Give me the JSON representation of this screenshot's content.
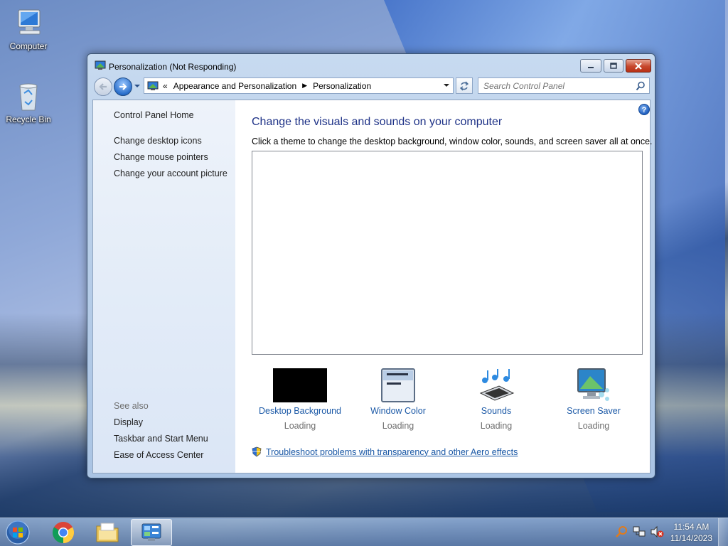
{
  "desktop": {
    "icons": [
      {
        "label": "Computer",
        "icon": "computer-icon"
      },
      {
        "label": "Recycle Bin",
        "icon": "recycle-bin-icon"
      }
    ]
  },
  "window": {
    "title": "Personalization (Not Responding)",
    "address": {
      "overflow": "«",
      "crumbs": [
        "Appearance and Personalization",
        "Personalization"
      ]
    },
    "search": {
      "placeholder": "Search Control Panel"
    },
    "sidebar": {
      "home": "Control Panel Home",
      "links": [
        "Change desktop icons",
        "Change mouse pointers",
        "Change your account picture"
      ],
      "see_also_label": "See also",
      "see_also": [
        "Display",
        "Taskbar and Start Menu",
        "Ease of Access Center"
      ]
    },
    "main": {
      "heading": "Change the visuals and sounds on your computer",
      "subheading": "Click a theme to change the desktop background, window color, sounds, and screen saver all at once.",
      "items": [
        {
          "label": "Desktop Background",
          "status": "Loading",
          "icon": "desktop-background-icon"
        },
        {
          "label": "Window Color",
          "status": "Loading",
          "icon": "window-color-icon"
        },
        {
          "label": "Sounds",
          "status": "Loading",
          "icon": "sounds-icon"
        },
        {
          "label": "Screen Saver",
          "status": "Loading",
          "icon": "screen-saver-icon"
        }
      ],
      "troubleshoot": "Troubleshoot problems with transparency and other Aero effects"
    }
  },
  "taskbar": {
    "apps": [
      "chrome-icon",
      "file-explorer-icon",
      "control-panel-icon"
    ],
    "clock": {
      "time": "11:54 AM",
      "date": "11/14/2023"
    }
  },
  "colors": {
    "link": "#1a58a6",
    "heading": "#1e3287",
    "close_button": "#c7472d"
  }
}
